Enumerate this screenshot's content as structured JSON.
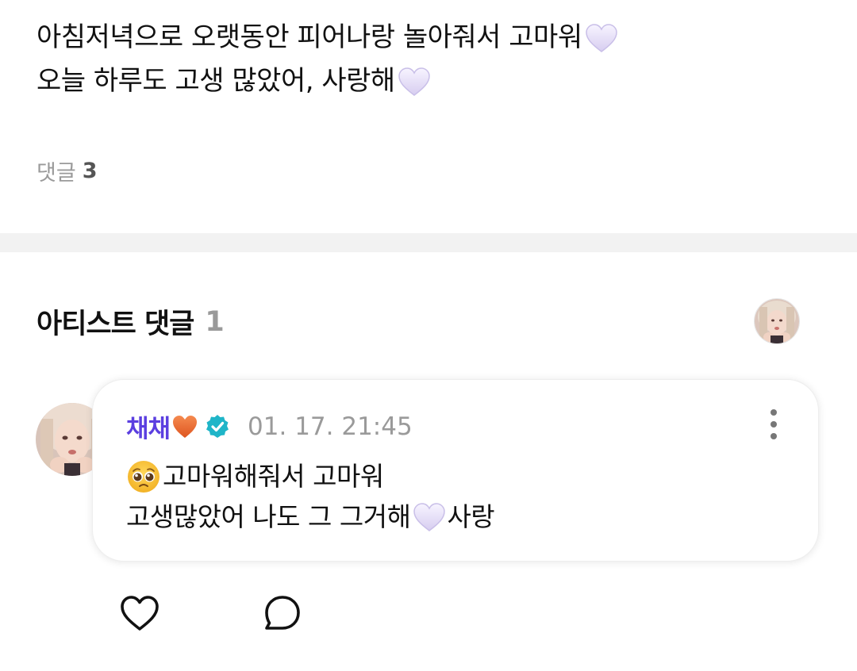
{
  "post": {
    "line1": "아침저녁으로 오랫동안 피어나랑 놀아줘서 고마워",
    "line2": "오늘 하루도 고생 많았어, 사랑해"
  },
  "comments_summary": {
    "label": "댓글",
    "count": "3"
  },
  "artist_comments": {
    "title": "아티스트 댓글",
    "count": "1"
  },
  "comment": {
    "author": "채채",
    "timestamp": "01. 17. 21:45",
    "line1": "고마워해줘서 고마워",
    "line2_part1": "고생많았어 나도 그 그거해",
    "line2_part2": "사랑"
  },
  "colors": {
    "author": "#5b3fe0",
    "verified": "#1fb5c8",
    "heart_emoji": "#e8e3f7",
    "orange_heart": "#ee6b2f"
  },
  "icons": {
    "heart_emoji": "white-heart-icon",
    "orange_heart": "orange-heart-icon",
    "verified": "verified-badge-icon",
    "more": "more-vertical-icon",
    "like": "heart-outline-icon",
    "reply": "comment-bubble-icon",
    "pleading": "pleading-face-icon"
  }
}
